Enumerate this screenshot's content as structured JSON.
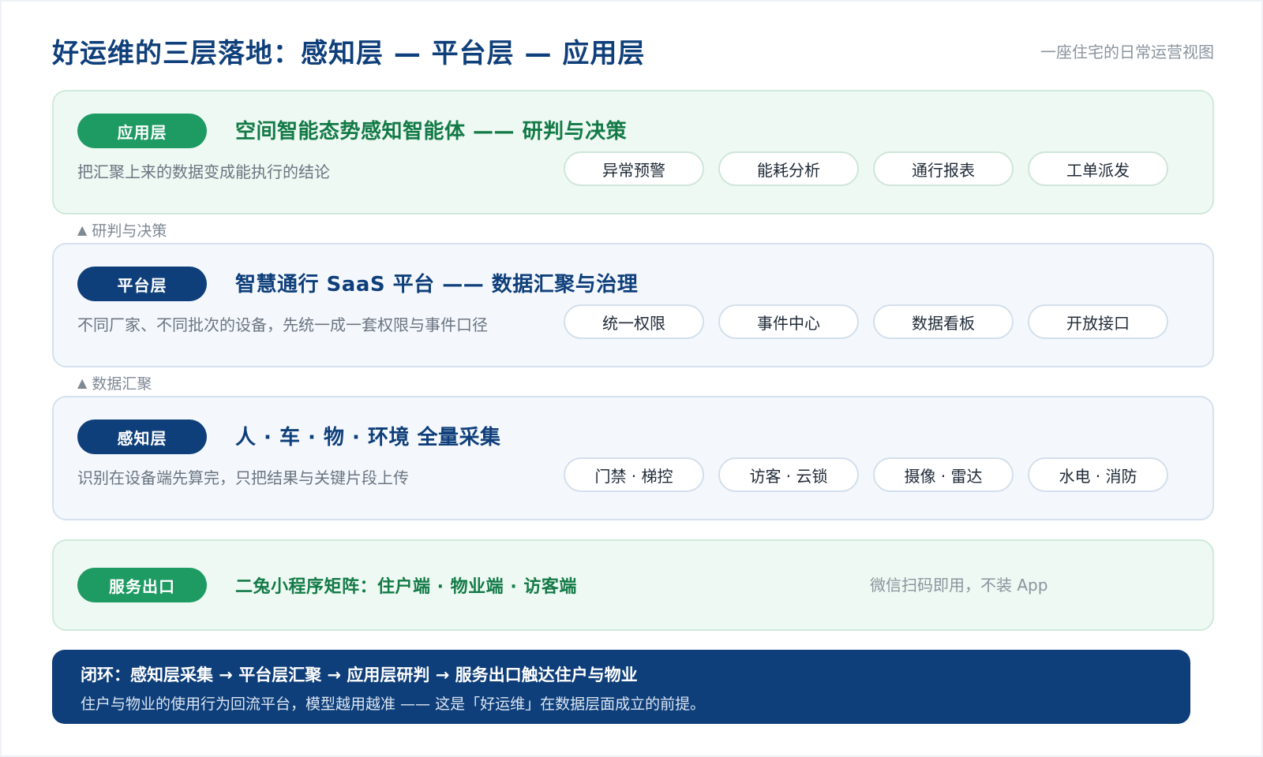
{
  "header": {
    "title": "好运维的三层落地：感知层 — 平台层 — 应用层",
    "subtitle": "一座住宅的日常运营视图"
  },
  "layers": {
    "application": {
      "badge": "应用层",
      "title": "空间智能态势感知智能体 —— 研判与决策",
      "desc": "把汇聚上来的数据变成能执行的结论",
      "chips": [
        "异常预警",
        "能耗分析",
        "通行报表",
        "工单派发"
      ]
    },
    "platform": {
      "badge": "平台层",
      "title": "智慧通行 SaaS 平台 —— 数据汇聚与治理",
      "desc": "不同厂家、不同批次的设备，先统一成一套权限与事件口径",
      "chips": [
        "统一权限",
        "事件中心",
        "数据看板",
        "开放接口"
      ]
    },
    "perception": {
      "badge": "感知层",
      "title": "人 · 车 · 物 · 环境 全量采集",
      "desc": "识别在设备端先算完，只把结果与关键片段上传",
      "chips": [
        "门禁 · 梯控",
        "访客 · 云锁",
        "摄像 · 雷达",
        "水电 · 消防"
      ]
    },
    "service": {
      "badge": "服务出口",
      "title": "二兔小程序矩阵：住户端 · 物业端 · 访客端",
      "note": "微信扫码即用，不装 App"
    }
  },
  "connectors": {
    "to_application": "研判与决策",
    "to_platform": "数据汇聚"
  },
  "footer": {
    "line1": "闭环：感知层采集 → 平台层汇聚 → 应用层研判 → 服务出口触达住户与物业",
    "line2": "住户与物业的使用行为回流平台，模型越用越准 —— 这是「好运维」在数据层面成立的前提。"
  },
  "colors": {
    "navy": "#0f3f7a",
    "green": "#1e9a63",
    "green_text": "#137a47",
    "green_panel": "#eef9f3",
    "blue_panel": "#f4f8fd"
  }
}
